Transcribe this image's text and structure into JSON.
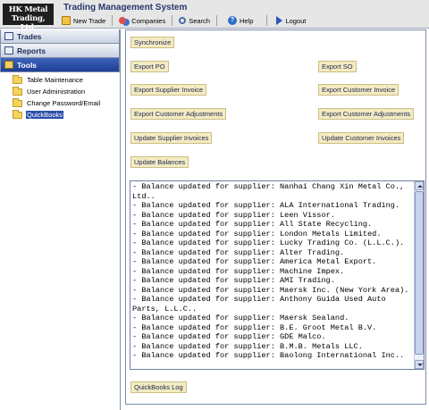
{
  "logo": {
    "line1": "HK Metal",
    "line2": "Trading, Ltd."
  },
  "app_title": "Trading Management System",
  "toolbar": [
    {
      "label": "New Trade",
      "icon": "new-trade-icon"
    },
    {
      "label": "Companies",
      "icon": "companies-icon"
    },
    {
      "label": "Search",
      "icon": "search-icon"
    },
    {
      "label": "Help",
      "icon": "help-icon"
    },
    {
      "label": "Logout",
      "icon": "logout-icon"
    }
  ],
  "sidebar": {
    "sections": [
      {
        "label": "Trades"
      },
      {
        "label": "Reports"
      },
      {
        "label": "Tools"
      }
    ],
    "tools_items": [
      {
        "label": "Table Maintenance"
      },
      {
        "label": "User Administration"
      },
      {
        "label": "Change Password/Email"
      },
      {
        "label": "QuickBooks"
      }
    ]
  },
  "main": {
    "buttons": {
      "synchronize": "Synchronize",
      "export_po": "Export PO",
      "export_so": "Export SO",
      "export_supplier_invoice": "Export Supplier Invoice",
      "export_customer_invoice": "Export Customer Invoice",
      "export_customer_adjustments_left": "Export Customer Adjustments",
      "export_customer_adjustments_right": "Export Customer Adjustments",
      "update_supplier_invoices": "Update Supplier Invoices",
      "update_customer_invoices": "Update Customer Invoices",
      "update_balances": "Update Balances",
      "quickbooks_log": "QuickBooks Log"
    },
    "log_lines": [
      "- Balance updated for supplier: Nanhai Chang Xin Metal Co., Ltd..",
      "- Balance updated for supplier: ALA International Trading.",
      "- Balance updated for supplier: Leen Vissor.",
      "- Balance updated for supplier: All State Recycling.",
      "- Balance updated for supplier: London Metals Limited.",
      "- Balance updated for supplier: Lucky Trading Co. (L.L.C.).",
      "- Balance updated for supplier: Alter Trading.",
      "- Balance updated for supplier: America Metal Export.",
      "- Balance updated for supplier: Machine Impex.",
      "- Balance updated for supplier: AMI Trading.",
      "- Balance updated for supplier: Maersk Inc. (New York Area).",
      "- Balance updated for supplier: Anthony Guida Used Auto Parts, L.L.C..",
      "- Balance updated for supplier: Maersk Sealand.",
      "- Balance updated for supplier: B.E. Groot Metal B.V.",
      "- Balance updated for supplier: GDE Malco.",
      "- Balance updated for supplier: B.M.B. Metals LLC.",
      "- Balance updated for supplier: Baolong International Inc.."
    ]
  }
}
